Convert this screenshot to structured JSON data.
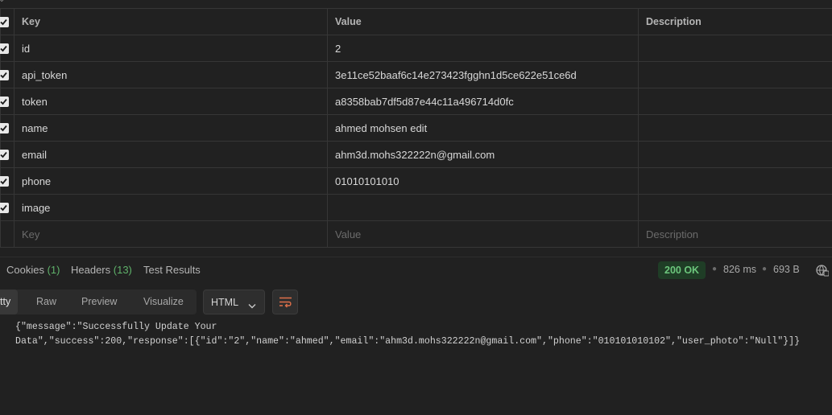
{
  "params": {
    "headers": {
      "key": "Key",
      "value": "Value",
      "description": "Description"
    },
    "rows": [
      {
        "key": "id",
        "value": "2",
        "checked": true
      },
      {
        "key": "api_token",
        "value": "3e11ce52baaf6c14e273423fgghn1d5ce622e51ce6d",
        "checked": true
      },
      {
        "key": "token",
        "value": "a8358bab7df5d87e44c11a496714d0fc",
        "checked": true
      },
      {
        "key": "name",
        "value": "ahmed mohsen edit",
        "checked": true
      },
      {
        "key": "email",
        "value": "ahm3d.mohs322222n@gmail.com",
        "checked": true
      },
      {
        "key": "phone",
        "value": "01010101010",
        "checked": true
      },
      {
        "key": "image",
        "value": "",
        "checked": true
      }
    ],
    "placeholder": {
      "key": "Key",
      "value": "Value",
      "description": "Description"
    }
  },
  "response_tabs": {
    "cookies_label": "Cookies",
    "cookies_count": "(1)",
    "headers_label": "Headers",
    "headers_count": "(13)",
    "tests_label": "Test Results"
  },
  "response_meta": {
    "status": "200 OK",
    "time": "826 ms",
    "size": "693 B",
    "status_color": "#6cc67c",
    "icon": "globe-icon"
  },
  "view_tabs": {
    "pretty": "tty",
    "raw": "Raw",
    "preview": "Preview",
    "visualize": "Visualize",
    "format": "HTML"
  },
  "response_body": {
    "line1": "{\"message\":\"Successfully Update Your",
    "line2": "Data\",\"success\":200,\"response\":[{\"id\":\"2\",\"name\":\"ahmed\",\"email\":\"ahm3d.mohs322222n@gmail.com\",\"phone\":\"010101010102\",\"user_photo\":\"Null\"}]}"
  }
}
